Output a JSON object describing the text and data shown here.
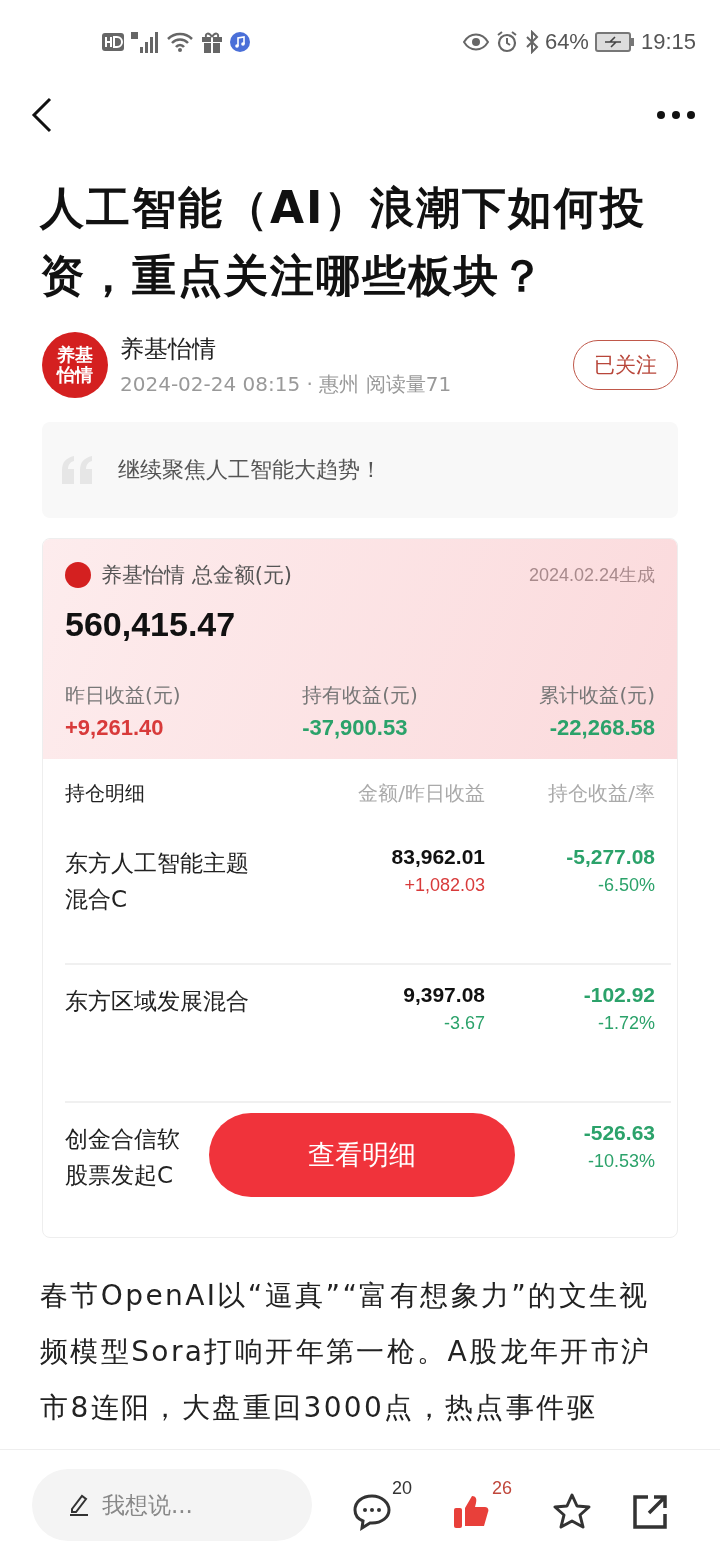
{
  "status_bar": {
    "battery": "64%",
    "time": "19:15"
  },
  "article": {
    "title": "人工智能（AI）浪潮下如何投资，重点关注哪些板块？",
    "author": {
      "avatar_text": "养基怡情",
      "name": "养基怡情",
      "meta": "2024-02-24 08:15 · 惠州 阅读量71",
      "follow_label": "已关注",
      "followed": true
    },
    "quote": "继续聚焦人工智能大趋势！",
    "card": {
      "brand": "养基怡情 总金额(元)",
      "generated": "2024.02.24生成",
      "total": "560,415.47",
      "stats": [
        {
          "label": "昨日收益(元)",
          "value": "+9,261.40",
          "color": "#d83a3a"
        },
        {
          "label": "持有收益(元)",
          "value": "-37,900.53",
          "color": "#2ba26a"
        },
        {
          "label": "累计收益(元)",
          "value": "-22,268.58",
          "color": "#2ba26a"
        }
      ],
      "columns": [
        "持仓明细",
        "金额/昨日收益",
        "持仓收益/率"
      ],
      "holdings": [
        {
          "name": [
            "东方人工智能主题",
            "混合C"
          ],
          "amount": "83,962.01",
          "daily": {
            "value": "+1,082.03",
            "color": "#d83a3a"
          },
          "profit": {
            "value": "-5,277.08",
            "color": "#2ba26a"
          },
          "rate": {
            "value": "-6.50%",
            "color": "#2ba26a"
          }
        },
        {
          "name": [
            "东方区域发展混合"
          ],
          "amount": "9,397.08",
          "daily": {
            "value": "-3.67",
            "color": "#2ba26a"
          },
          "profit": {
            "value": "-102.92",
            "color": "#2ba26a"
          },
          "rate": {
            "value": "-1.72%",
            "color": "#2ba26a"
          }
        },
        {
          "name": [
            "创金合信软",
            "股票发起C"
          ],
          "profit": {
            "value": "-526.63",
            "color": "#2ba26a"
          },
          "rate": {
            "value": "-10.53%",
            "color": "#2ba26a"
          }
        }
      ],
      "detail_button": "查看明细"
    },
    "body": "春节OpenAI以“逼真”“富有想象力”的文生视频模型Sora打响开年第一枪。A股龙年开市沪市8连阳，大盘重回3000点，热点事件驱"
  },
  "bottom_bar": {
    "comment_placeholder": "我想说...",
    "comments": "20",
    "likes": "26",
    "liked": true,
    "starred": false
  }
}
